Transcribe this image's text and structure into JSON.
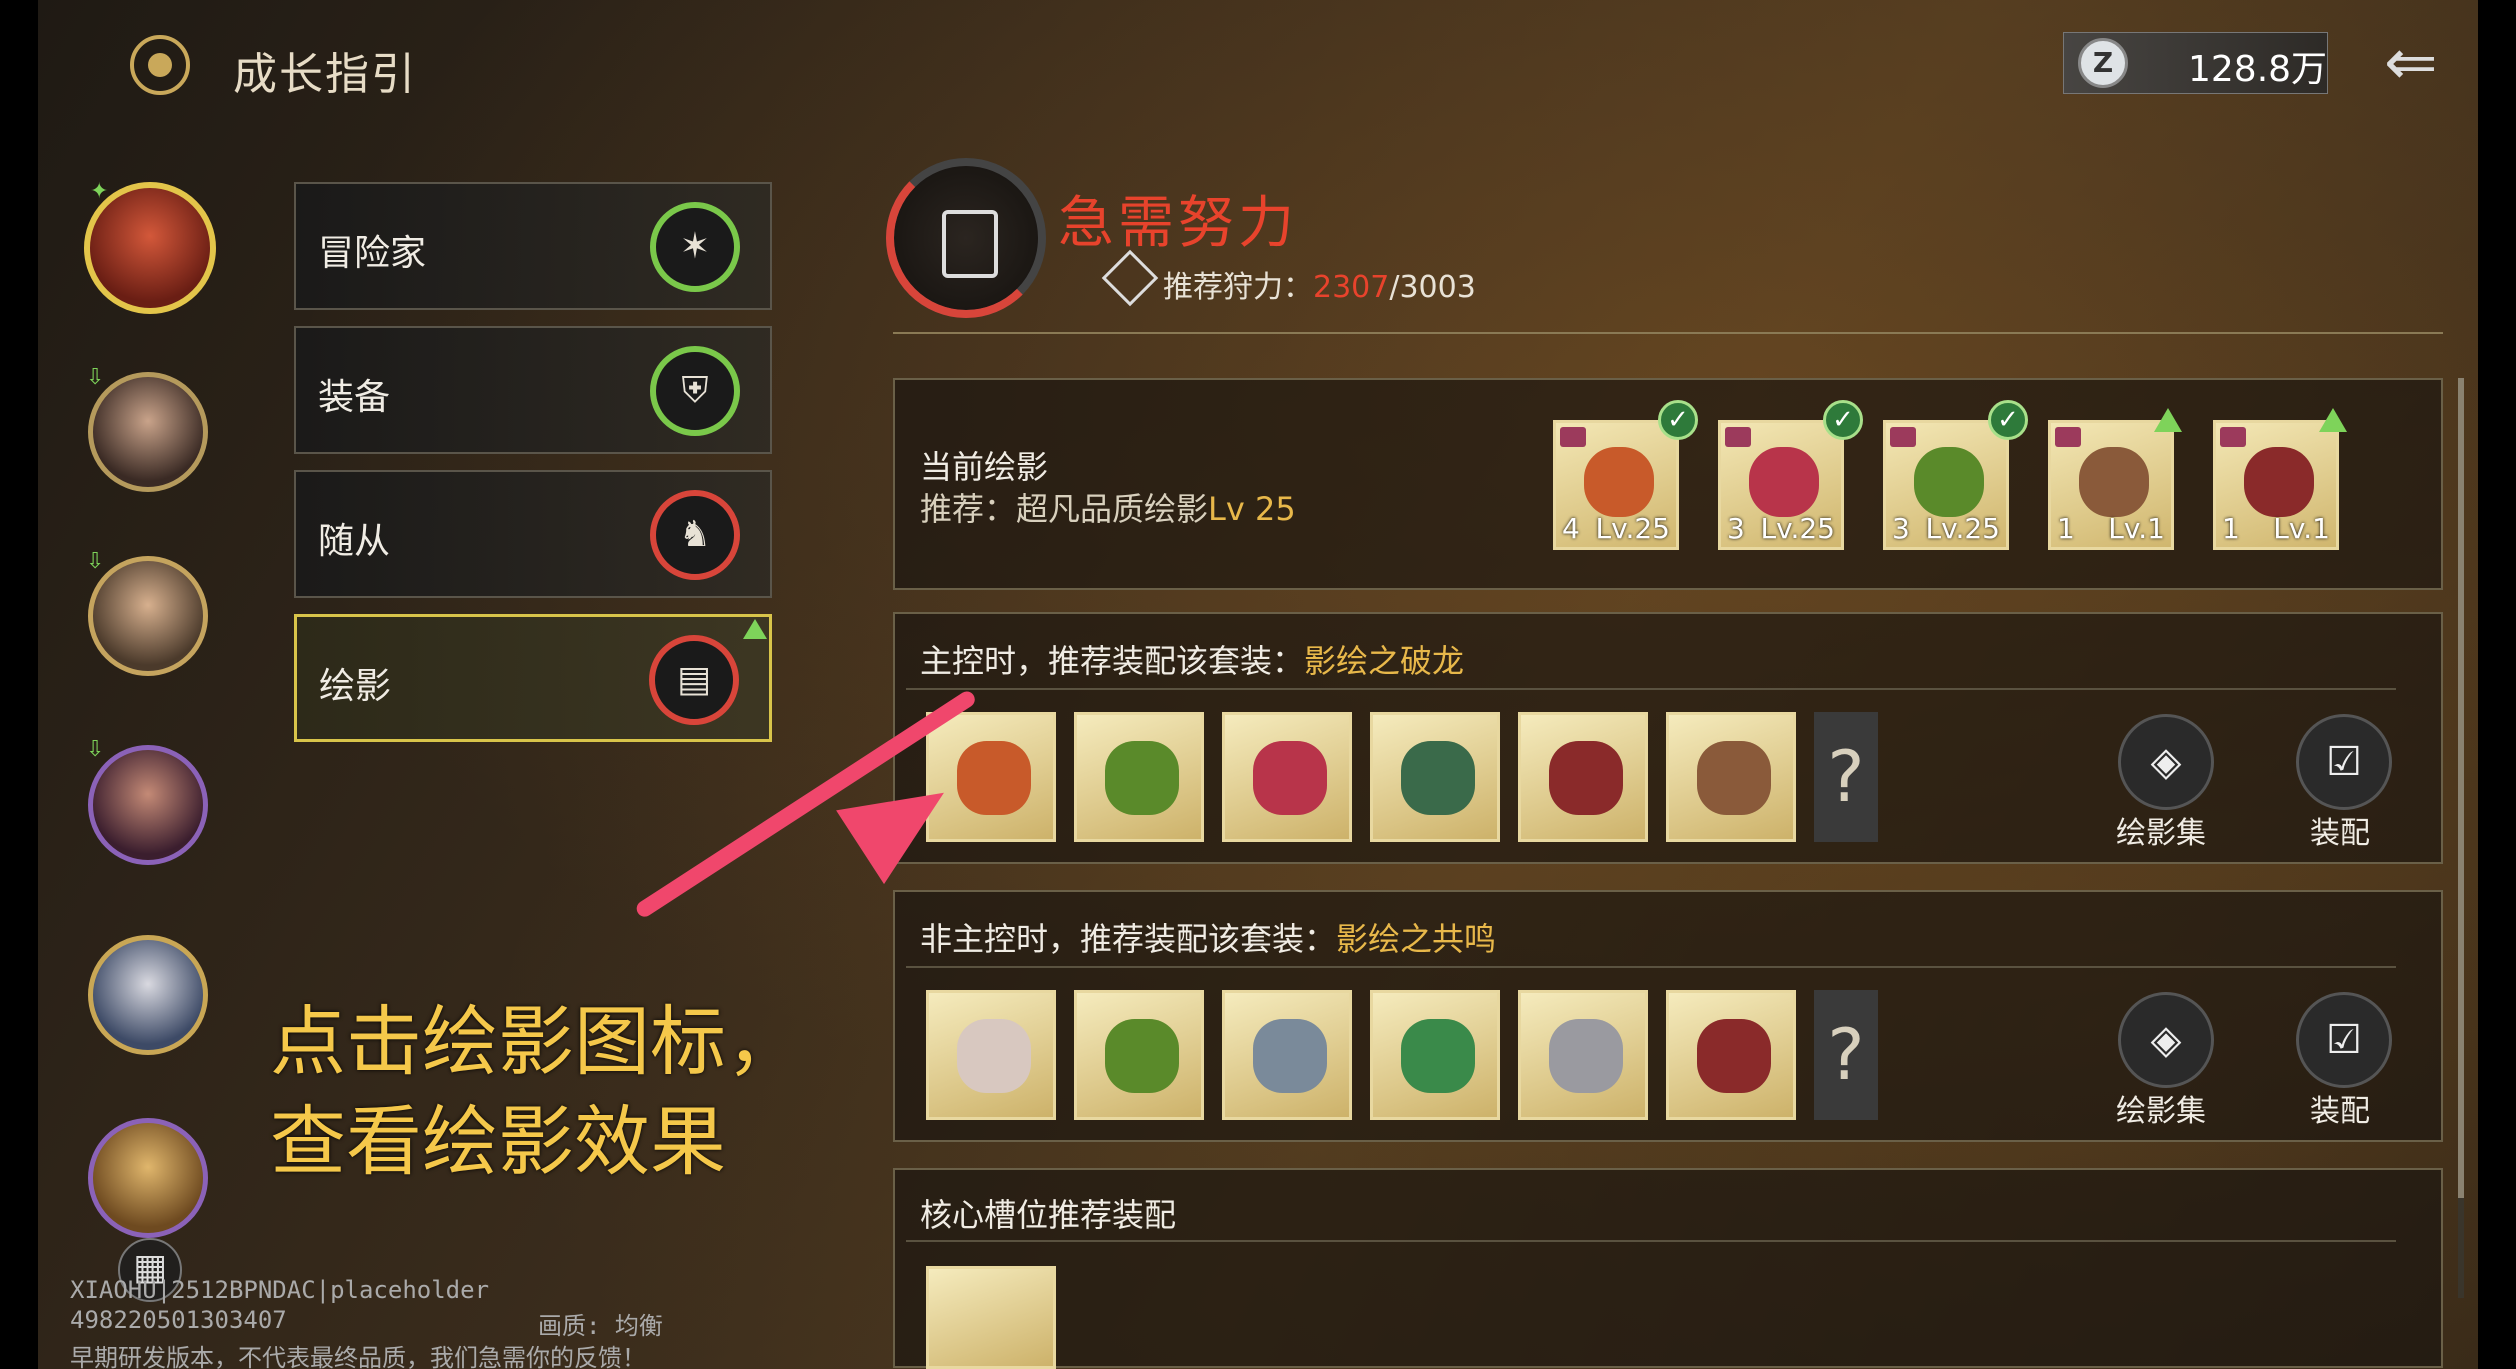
{
  "header": {
    "title": "成长指引",
    "currency_value": "128.8万",
    "currency_icon": "z-coin-icon",
    "back_icon": "back-arrow-icon"
  },
  "tabs": [
    {
      "label": "冒险家",
      "status": "green"
    },
    {
      "label": "装备",
      "status": "green"
    },
    {
      "label": "随从",
      "status": "red"
    },
    {
      "label": "绘影",
      "status": "red",
      "active": true
    }
  ],
  "status": {
    "title": "急需努力",
    "rec_label": "推荐狩力：",
    "rec_current": "2307",
    "rec_total": "/3003"
  },
  "current": {
    "label": "当前绘影",
    "rec_prefix": "推荐：超凡品质绘影",
    "rec_lv": "Lv 25",
    "cards": [
      {
        "num": "4",
        "lv": "Lv.25",
        "badge": "check",
        "color": "#c85a2a"
      },
      {
        "num": "3",
        "lv": "Lv.25",
        "badge": "check",
        "color": "#b8344a"
      },
      {
        "num": "3",
        "lv": "Lv.25",
        "badge": "check",
        "color": "#5a8a2a"
      },
      {
        "num": "1",
        "lv": "Lv.1",
        "badge": "up",
        "color": "#8a5a3a"
      },
      {
        "num": "1",
        "lv": "Lv.1",
        "badge": "up",
        "color": "#8a2a2a"
      }
    ]
  },
  "main_control": {
    "prefix": "主控时，推荐装配该套装：",
    "set_name": "影绘之破龙",
    "card_colors": [
      "#c85a2a",
      "#5a8a2a",
      "#b8344a",
      "#3a6a4a",
      "#8a2a2a",
      "#8a5a3a"
    ],
    "qmark": "?",
    "collection_label": "绘影集",
    "equip_label": "装配"
  },
  "non_main_control": {
    "prefix": "非主控时，推荐装配该套装：",
    "set_name": "影绘之共鸣",
    "card_colors": [
      "#d8c8c0",
      "#5a8a2a",
      "#7a8a9a",
      "#3a8a4a",
      "#9a9aa0",
      "#8a2a2a"
    ],
    "qmark": "?",
    "collection_label": "绘影集",
    "equip_label": "装配"
  },
  "core_slot": {
    "title": "核心槽位推荐装配"
  },
  "hint": {
    "line1": "点击绘影图标，",
    "line2": "查看绘影效果"
  },
  "watermark": {
    "line1": "XIAOHU|2512BPNDAC|placeholder",
    "line2": "498220501303407",
    "quality": "画质: 均衡",
    "line3": "早期研发版本，不代表最终品质，我们急需你的反馈！"
  },
  "colors": {
    "accent_red": "#e8432c",
    "accent_gold": "#e8b84a",
    "active_border": "#d8c44a",
    "hint_yellow": "#f5c84a",
    "arrow_pink": "#f0476c"
  }
}
